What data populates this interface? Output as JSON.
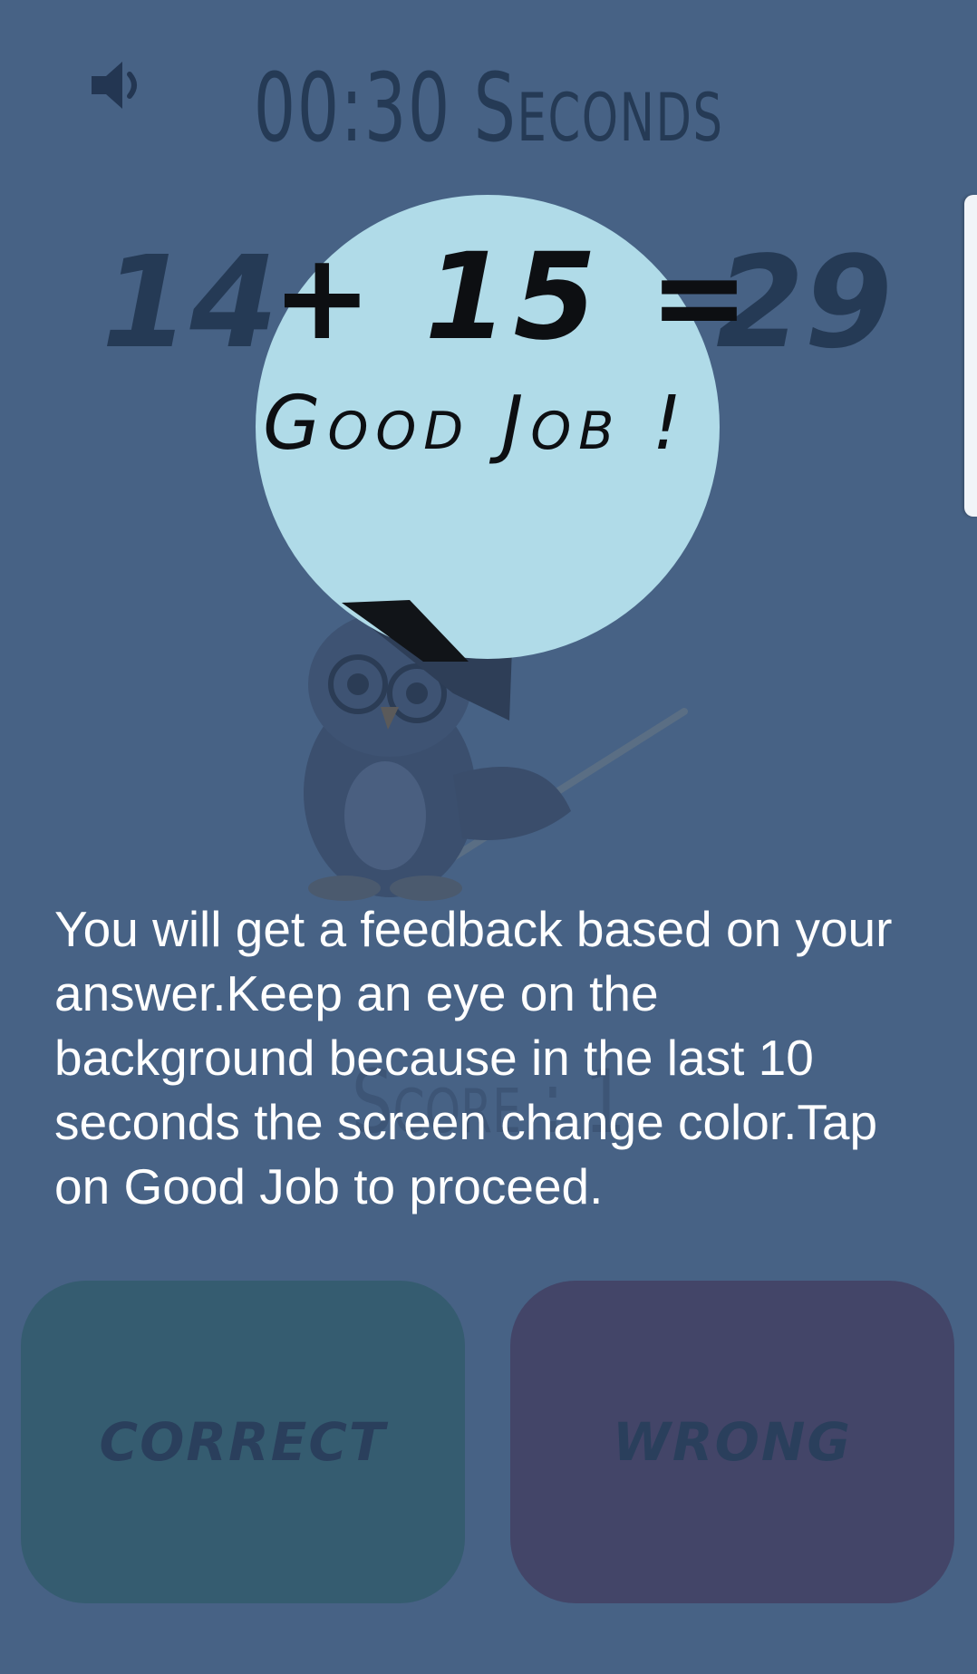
{
  "header": {
    "timer_text": "00:30 Seconds",
    "sound_icon": "speaker-icon"
  },
  "equation": {
    "left": "14",
    "operator_and_right": "+ 15 =",
    "result": "29"
  },
  "score": {
    "text": "Score : 1"
  },
  "feedback": {
    "message": "Good Job !"
  },
  "tutorial": {
    "text": "You will get a feedback based on your answer.Keep an eye on the background because in the last 10 seconds the screen change color.Tap on Good Job to proceed."
  },
  "buttons": {
    "correct_label": "CORRECT",
    "wrong_label": "WRONG"
  },
  "colors": {
    "background": "#476285",
    "bubble": "#b0dbe8",
    "correct_button": "#355c70",
    "wrong_button": "#434568"
  }
}
